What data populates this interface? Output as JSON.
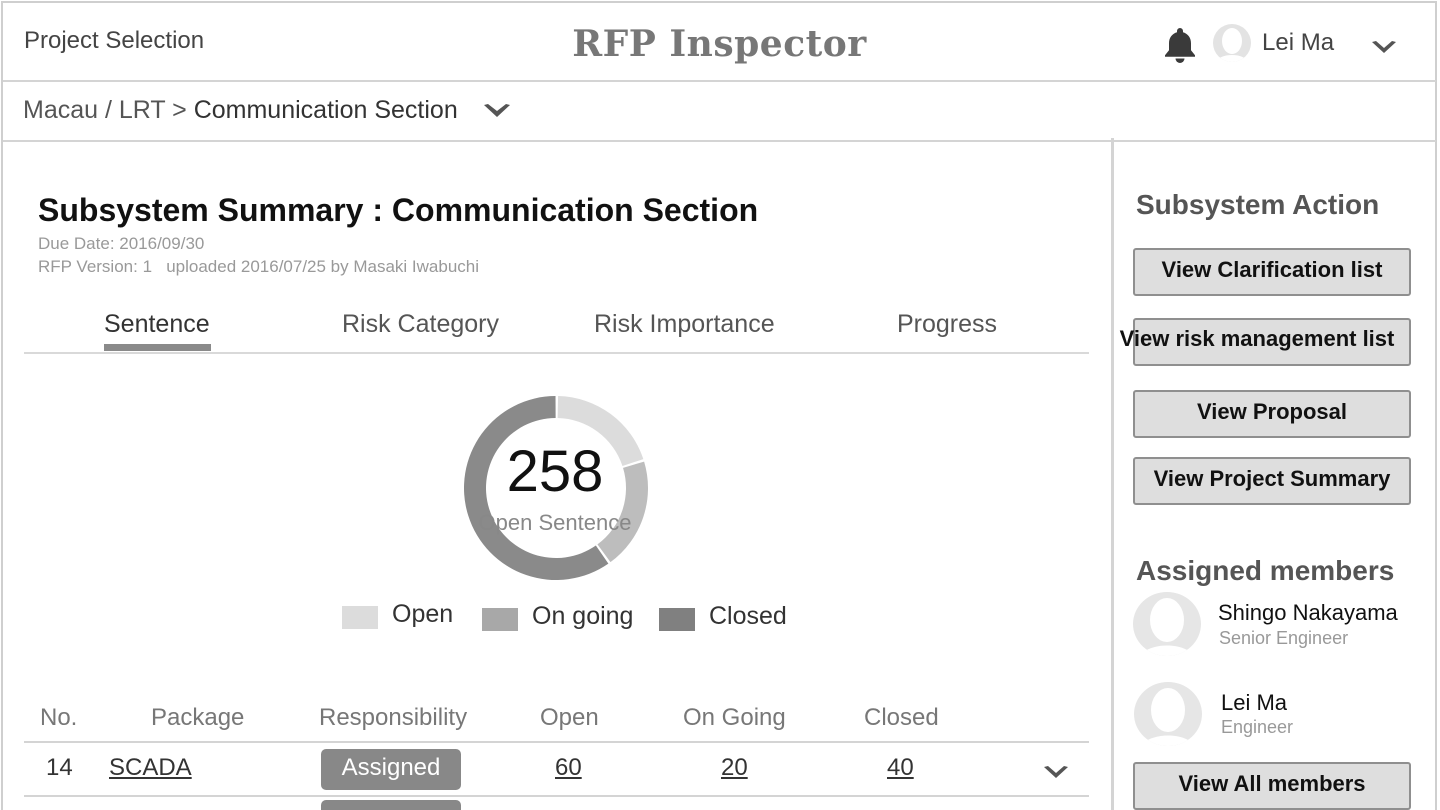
{
  "header": {
    "project_selection": "Project Selection",
    "app_title": "RFP Inspector",
    "user_name": "Lei Ma"
  },
  "breadcrumb": {
    "path": "Macau / LRT > ",
    "current": "Communication Section"
  },
  "summary": {
    "title": "Subsystem Summary : Communication Section",
    "due_date": "Due Date: 2016/09/30",
    "rfp_version": "RFP Version: 1   uploaded 2016/07/25 by Masaki Iwabuchi"
  },
  "tabs": [
    "Sentence",
    "Risk Category",
    "Risk Importance",
    "Progress"
  ],
  "chart_data": {
    "type": "pie",
    "center_value": "258",
    "center_label": "Open Sentence",
    "slices": [
      {
        "name": "Open",
        "value": 20,
        "color": "#dcdcdc"
      },
      {
        "name": "On going",
        "value": 20,
        "color": "#bdbdbd"
      },
      {
        "name": "Closed",
        "value": 60,
        "color": "#8a8a8a"
      }
    ],
    "legend": [
      {
        "label": "Open",
        "color": "#dcdcdc"
      },
      {
        "label": "On going",
        "color": "#a8a8a8"
      },
      {
        "label": "Closed",
        "color": "#808080"
      }
    ]
  },
  "table": {
    "headers": [
      "No.",
      "Package",
      "Responsibility",
      "Open",
      "On Going",
      "Closed"
    ],
    "rows": [
      {
        "no": "14",
        "package": "SCADA",
        "responsibility": "Assigned",
        "open": "60",
        "ongoing": "20",
        "closed": "40"
      }
    ]
  },
  "sidebar": {
    "action_heading": "Subsystem Action",
    "buttons": [
      "View Clarification list",
      "View risk management list",
      "View Proposal",
      "View Project Summary"
    ],
    "members_heading": "Assigned members",
    "members": [
      {
        "name": "Shingo Nakayama",
        "role": "Senior Engineer"
      },
      {
        "name": "Lei Ma",
        "role": "Engineer"
      }
    ],
    "view_all": "View All members"
  }
}
